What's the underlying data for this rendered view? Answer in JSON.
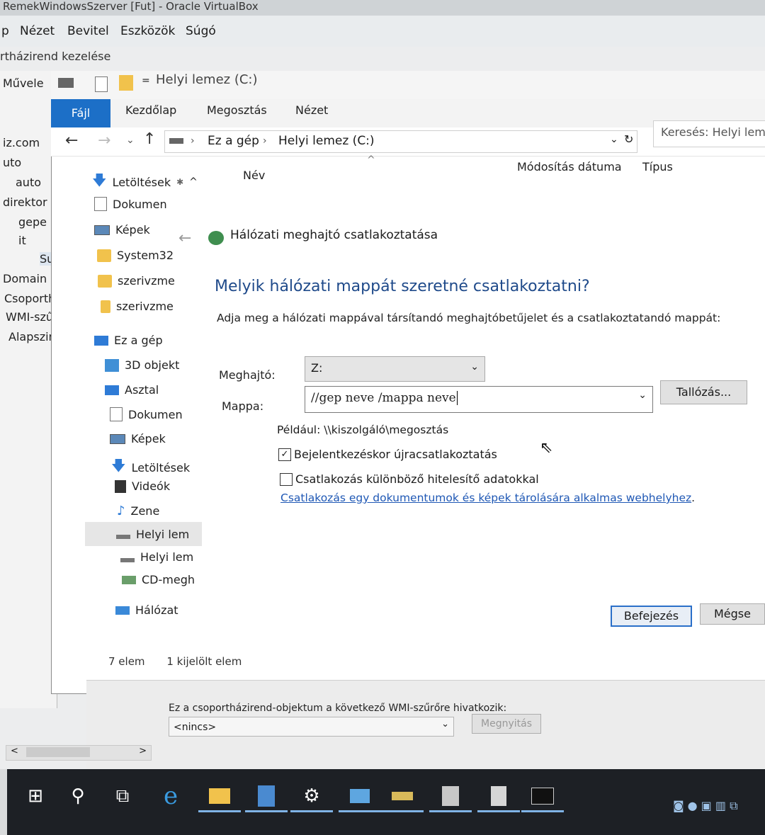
{
  "vbox": {
    "title": "RemekWindowsSzerver [Fut] - Oracle VirtualBox",
    "menu": [
      "p",
      "Nézet",
      "Bevitel",
      "Eszközök",
      "Súgó"
    ]
  },
  "gpme": {
    "title": "rtházirend kezelése",
    "menu_action": "Művele",
    "left_tree": [
      "iz.com",
      "uto",
      "auto",
      "direktor",
      "gepe",
      "it",
      "Su",
      "Domain",
      "Csoporth",
      "WMI-szű",
      "Alapszint"
    ],
    "wmi_label": "Ez a csoportházirend-objektum a következő WMI-szűrőre hivatkozik:",
    "wmi_value": "<nincs>",
    "open_button": "Megnyitás"
  },
  "explorer": {
    "window_title": "Helyi lemez (C:)",
    "tabs": {
      "file": "Fájl",
      "home": "Kezdőlap",
      "share": "Megosztás",
      "view": "Nézet"
    },
    "breadcrumb": {
      "pc": "Ez a gép",
      "drive": "Helyi lemez (C:)"
    },
    "search_placeholder": "Keresés: Helyi lem",
    "columns": {
      "name": "Név",
      "date": "Módosítás dátuma",
      "type": "Típus"
    },
    "quick_access": [
      "Letöltések",
      "Dokumen",
      "Képek",
      "System32",
      "szerivzme",
      "szerivzme"
    ],
    "this_pc": "Ez a gép",
    "this_pc_items": [
      "3D objekt",
      "Asztal",
      "Dokumen",
      "Képek",
      "Letöltések",
      "Videók",
      "Zene",
      "Helyi lem",
      "Helyi lem",
      "CD-megh"
    ],
    "network": "Hálózat",
    "status_count": "7 elem",
    "status_selected": "1 kijelölt elem"
  },
  "dialog": {
    "title": "Hálózati meghajtó csatlakoztatása",
    "heading": "Melyik hálózati mappát szeretné csatlakoztatni?",
    "instruction": "Adja meg a hálózati mappával társítandó meghajtóbetűjelet és a csatlakoztatandó mappát:",
    "drive_label": "Meghajtó:",
    "drive_value": "Z:",
    "folder_label": "Mappa:",
    "folder_value": "//gep neve /mappa neve",
    "browse_button": "Tallózás...",
    "example": "Például: \\\\kiszolgáló\\megosztás",
    "reconnect_label": "Bejelentkezéskor újracsatlakoztatás",
    "reconnect_checked": true,
    "diff_creds_label": "Csatlakozás különböző hitelesítő adatokkal",
    "diff_creds_checked": false,
    "website_link": "Csatlakozás egy dokumentumok és képek tárolására alkalmas webhelyhez",
    "finish_button": "Befejezés",
    "cancel_button": "Mégse"
  },
  "colors": {
    "accent": "#1c6fc7",
    "link": "#1f58b5",
    "taskbar": "#1d2025"
  }
}
